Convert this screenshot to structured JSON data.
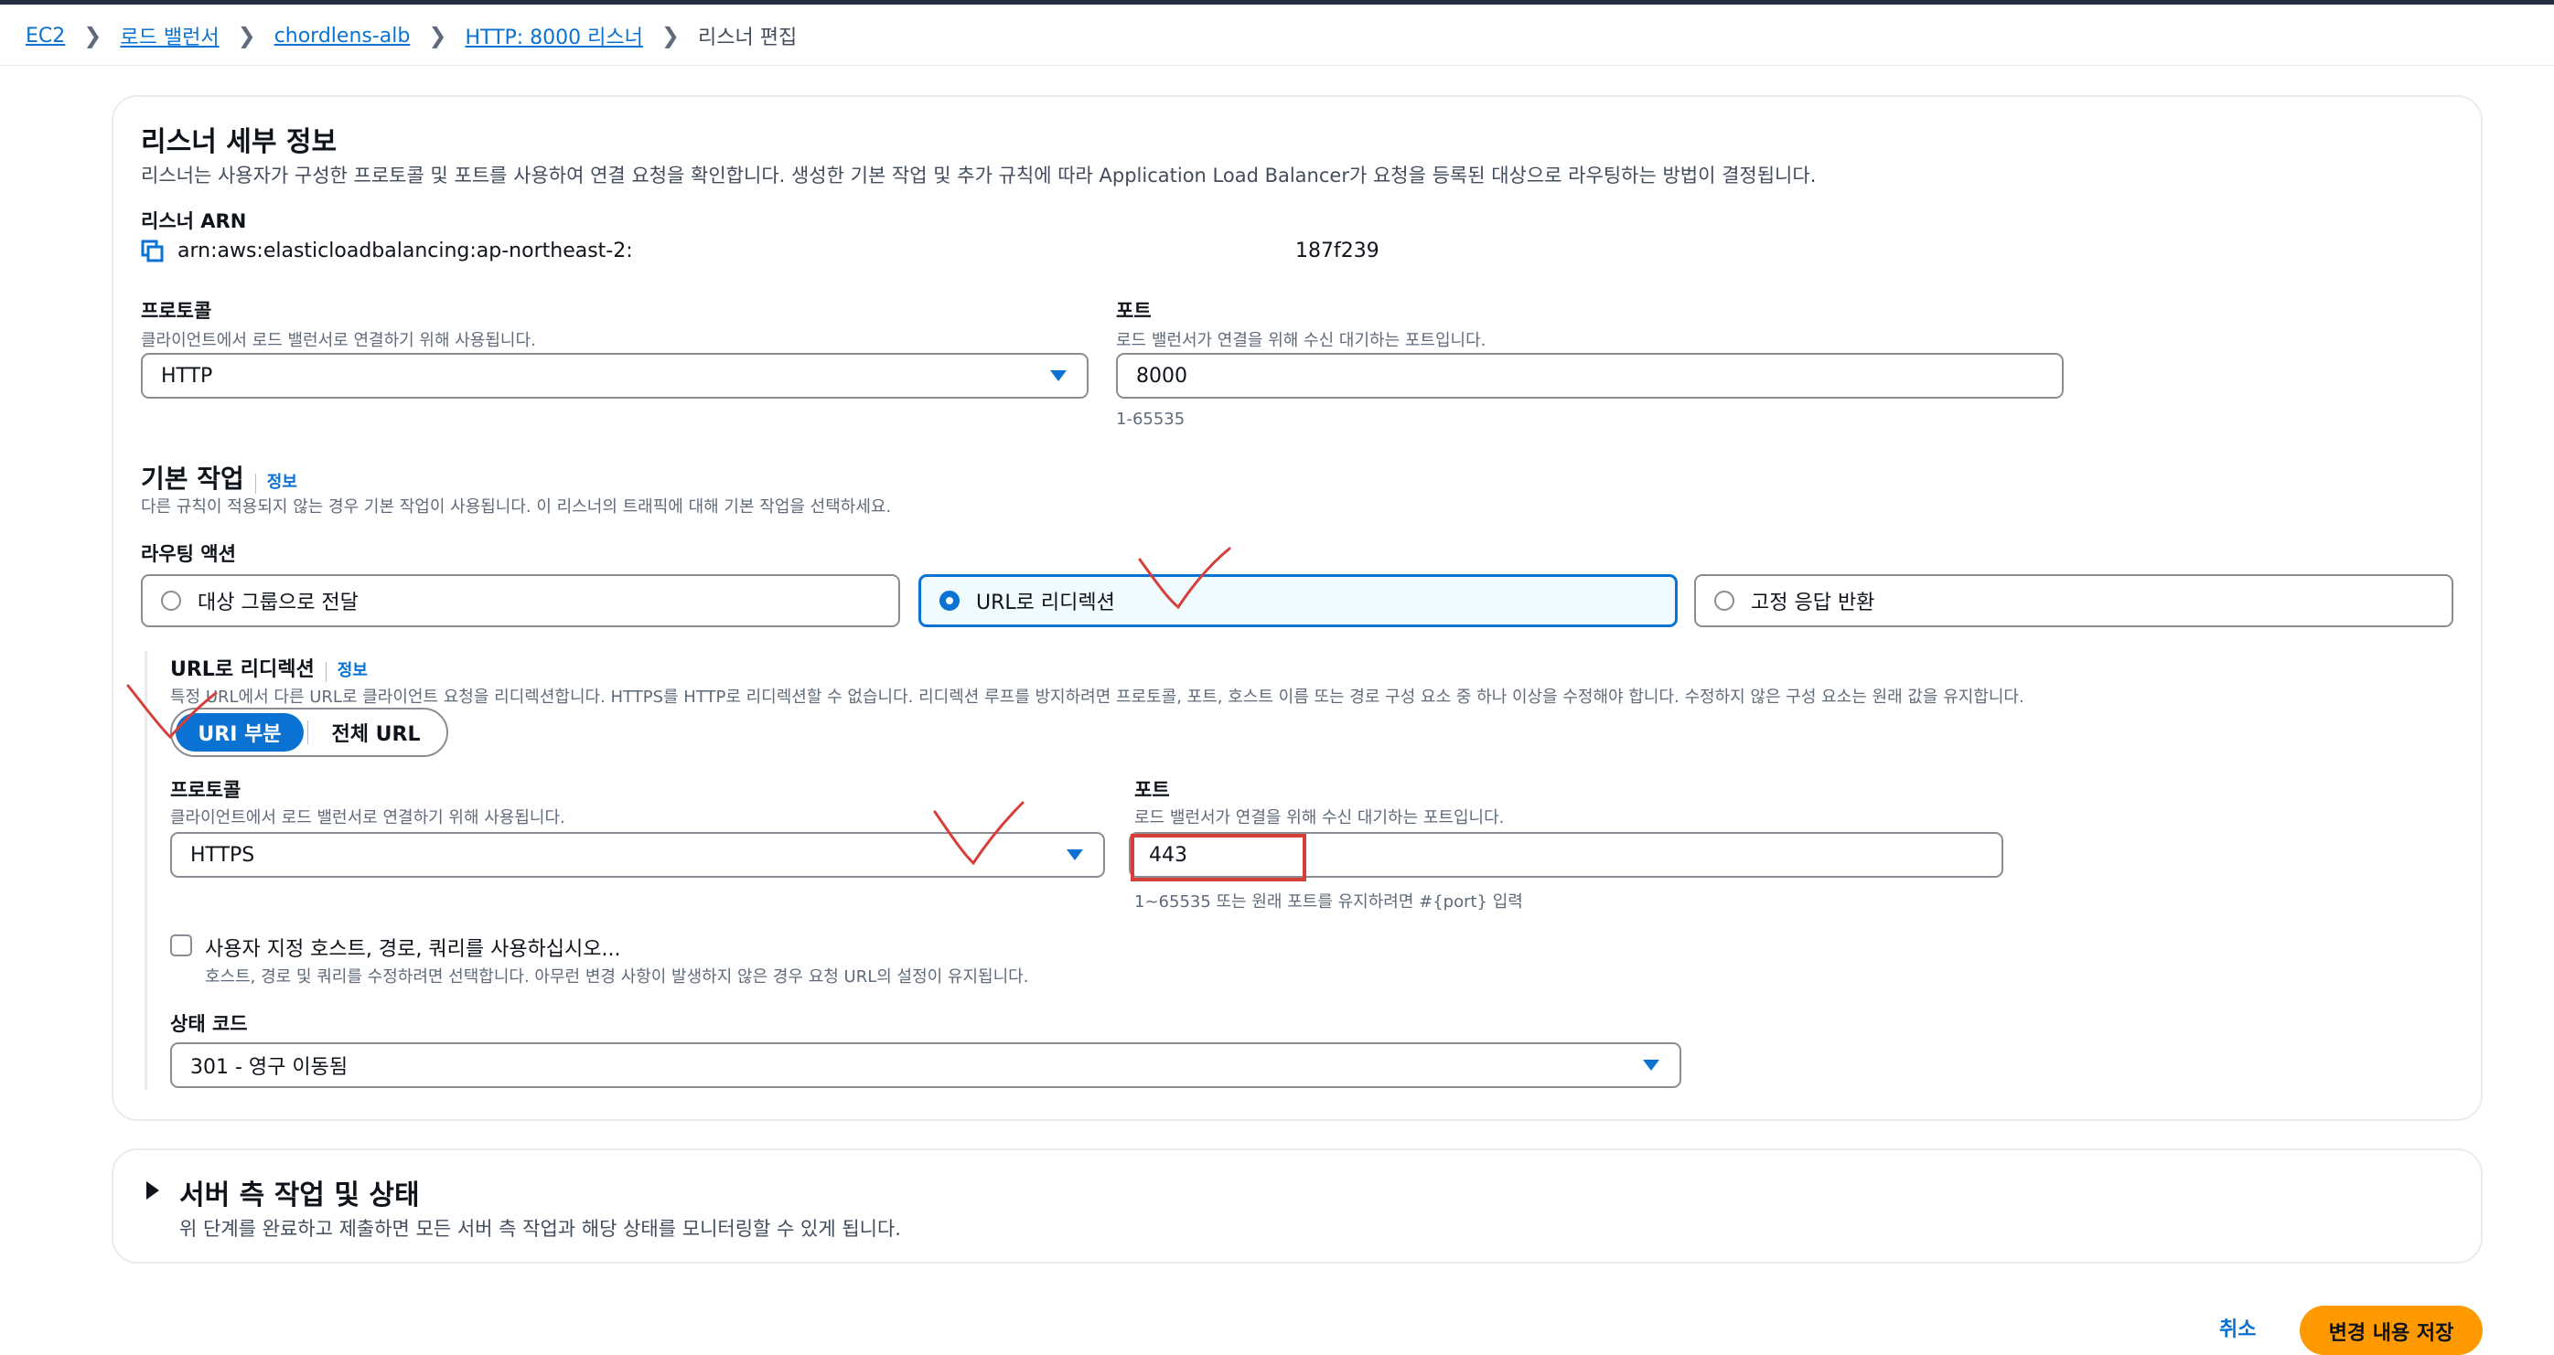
{
  "breadcrumb": {
    "items": [
      "EC2",
      "로드 밸런서",
      "chordlens-alb",
      "HTTP: 8000 리스너"
    ],
    "current": "리스너 편집"
  },
  "listener_details": {
    "title": "리스너 세부 정보",
    "description": "리스너는 사용자가 구성한 프로토콜 및 포트를 사용하여 연결 요청을 확인합니다. 생성한 기본 작업 및 추가 규칙에 따라 Application Load Balancer가 요청을 등록된 대상으로 라우팅하는 방법이 결정됩니다.",
    "arn_label": "리스너 ARN",
    "arn_prefix": "arn:aws:elasticloadbalancing:ap-northeast-2:",
    "arn_suffix": "187f239",
    "protocol": {
      "label": "프로토콜",
      "description": "클라이언트에서 로드 밸런서로 연결하기 위해 사용됩니다.",
      "value": "HTTP"
    },
    "port": {
      "label": "포트",
      "description": "로드 밸런서가 연결을 위해 수신 대기하는 포트입니다.",
      "value": "8000",
      "hint": "1-65535"
    }
  },
  "default_action": {
    "title": "기본 작업",
    "info": "정보",
    "description": "다른 규칙이 적용되지 않는 경우 기본 작업이 사용됩니다. 이 리스너의 트래픽에 대해 기본 작업을 선택하세요.",
    "routing_label": "라우팅 액션",
    "options": [
      "대상 그룹으로 전달",
      "URL로 리디렉션",
      "고정 응답 반환"
    ],
    "selected_index": 1
  },
  "redirect": {
    "title": "URL로 리디렉션",
    "info": "정보",
    "description": "특정 URL에서 다른 URL로 클라이언트 요청을 리디렉션합니다. HTTPS를 HTTP로 리디렉션할 수 없습니다. 리디렉션 루프를 방지하려면 프로토콜, 포트, 호스트 이름 또는 경로 구성 요소 중 하나 이상을 수정해야 합니다. 수정하지 않은 구성 요소는 원래 값을 유지합니다.",
    "segment": [
      "URI 부분",
      "전체 URL"
    ],
    "protocol": {
      "label": "프로토콜",
      "description": "클라이언트에서 로드 밸런서로 연결하기 위해 사용됩니다.",
      "value": "HTTPS"
    },
    "port": {
      "label": "포트",
      "description": "로드 밸런서가 연결을 위해 수신 대기하는 포트입니다.",
      "value": "443",
      "hint": "1~65535 또는 원래 포트를 유지하려면 #{port} 입력"
    },
    "custom": {
      "label": "사용자 지정 호스트, 경로, 쿼리를 사용하십시오...",
      "description": "호스트, 경로 및 쿼리를 수정하려면 선택합니다. 아무런 변경 사항이 발생하지 않은 경우 요청 URL의 설정이 유지됩니다."
    },
    "status": {
      "label": "상태 코드",
      "value": "301 - 영구 이동됨"
    }
  },
  "server_side": {
    "title": "서버 측 작업 및 상태",
    "description": "위 단계를 완료하고 제출하면 모든 서버 측 작업과 해당 상태를 모니터링할 수 있게 됩니다."
  },
  "footer": {
    "cancel": "취소",
    "save": "변경 내용 저장"
  },
  "colors": {
    "accent": "#0972d3",
    "save_button": "#ff9900",
    "annotation": "#d63f38"
  }
}
